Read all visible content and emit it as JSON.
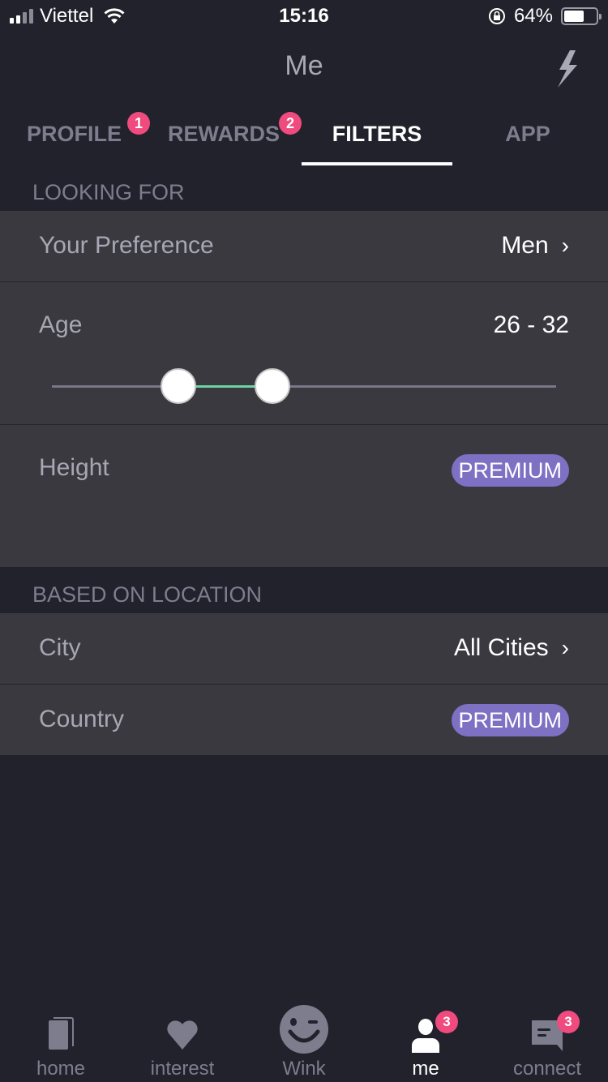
{
  "status_bar": {
    "carrier": "Viettel",
    "time": "15:16",
    "battery_percent_label": "64%",
    "battery_level": 0.64,
    "signal_bars": 2
  },
  "header": {
    "title": "Me",
    "action_icon": "lightning-bolt-icon"
  },
  "tabs": [
    {
      "label": "PROFILE",
      "badge": "1",
      "active": false
    },
    {
      "label": "REWARDS",
      "badge": "2",
      "active": false
    },
    {
      "label": "FILTERS",
      "badge": null,
      "active": true
    },
    {
      "label": "APP",
      "badge": null,
      "active": false
    }
  ],
  "sections": {
    "looking_for": {
      "title": "LOOKING FOR",
      "preference": {
        "label": "Your Preference",
        "value": "Men"
      },
      "age": {
        "label": "Age",
        "value_text": "26 - 32",
        "min": 26,
        "max": 32,
        "range_min": 18,
        "range_max": 50
      },
      "height": {
        "label": "Height",
        "badge": "PREMIUM"
      }
    },
    "based_on_location": {
      "title": "BASED ON LOCATION",
      "city": {
        "label": "City",
        "value": "All Cities"
      },
      "country": {
        "label": "Country",
        "badge": "PREMIUM"
      }
    }
  },
  "colors": {
    "accent_badge": "#ef4b7e",
    "premium": "#7e70c2",
    "slider_range": "#6fd2a4"
  },
  "bottom_nav": [
    {
      "label": "home",
      "icon": "cards-icon",
      "badge": null,
      "active": false
    },
    {
      "label": "interest",
      "icon": "heart-icon",
      "badge": null,
      "active": false
    },
    {
      "label": "Wink",
      "icon": "wink-face-icon",
      "badge": null,
      "active": false
    },
    {
      "label": "me",
      "icon": "person-icon",
      "badge": "3",
      "active": true
    },
    {
      "label": "connect",
      "icon": "chat-bubble-icon",
      "badge": "3",
      "active": false
    }
  ]
}
